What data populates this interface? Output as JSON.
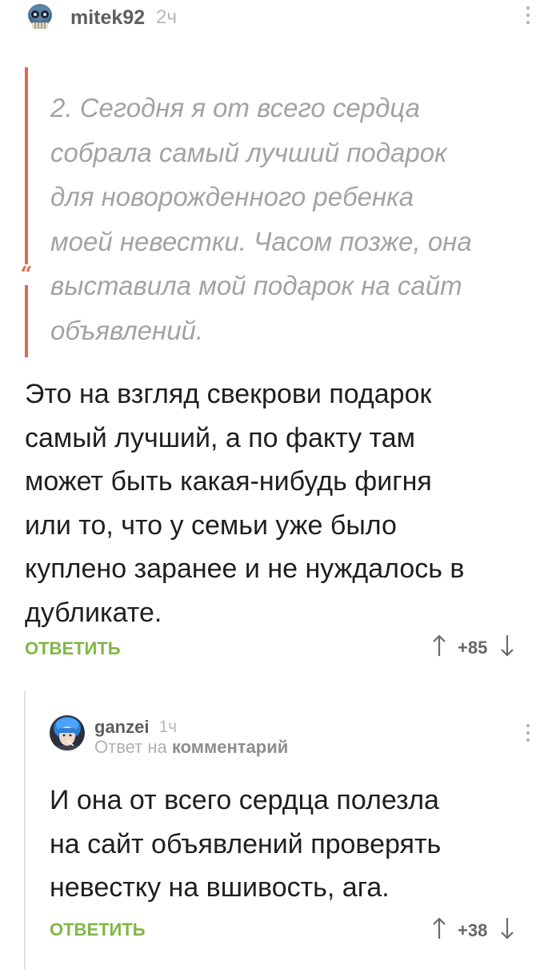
{
  "comment": {
    "username": "mitek92",
    "time": "2ч",
    "avatar_icon": "skull-avatar-icon",
    "quote_text": "2. Сегодня я от всего сердца\nсобрала самый лучший подарок\nдля новорожденного ребенка\nмоей невестки. Часом позже, она\nвыставила мой подарок на сайт\nобъявлений.",
    "body_text": "Это на взгляд свекрови подарок\nсамый лучший, а по факту там\nможет быть какая-нибудь фигня\nили то, что у семьи уже было\nкуплено заранее и не нуждалось в\nдубликате.",
    "reply_label": "ОТВЕТИТЬ",
    "score": "+85"
  },
  "reply": {
    "username": "ganzei",
    "time": "1ч",
    "avatar_icon": "blue-hair-avatar-icon",
    "reply_to_prefix": "Ответ на",
    "reply_to_target": "комментарий",
    "body_text": "И она от всего сердца полезла\nна сайт объявлений проверять\nневестку на вшивость, ага.",
    "reply_label": "ОТВЕТИТЬ",
    "score": "+38"
  },
  "colors": {
    "accent_green": "#7fb744",
    "quote_red": "#e1684f",
    "quote_text": "#a3a3a3"
  }
}
